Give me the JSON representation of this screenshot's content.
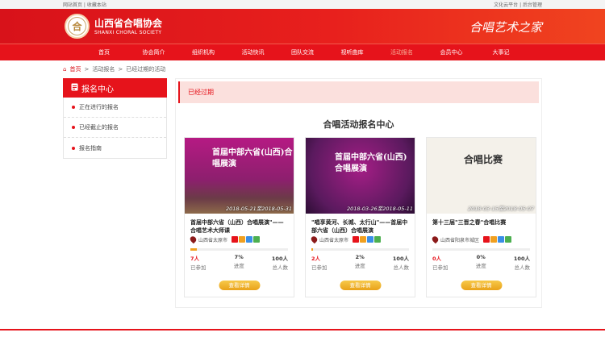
{
  "topbar": {
    "left": "网站首页 | 收藏本站",
    "right": "文化云平台 | 后台管理"
  },
  "brand": {
    "logo_glyph": "合",
    "name": "山西省合唱协会",
    "name_en": "SHANXI CHORAL SOCIETY",
    "slogan": "合唱艺术之家"
  },
  "nav": [
    {
      "label": "首页",
      "active": false
    },
    {
      "label": "协会简介",
      "active": false
    },
    {
      "label": "组织机构",
      "active": false
    },
    {
      "label": "活动快讯",
      "active": false
    },
    {
      "label": "团队交流",
      "active": false
    },
    {
      "label": "视听曲库",
      "active": false
    },
    {
      "label": "活动报名",
      "active": true
    },
    {
      "label": "会员中心",
      "active": false
    },
    {
      "label": "大事记",
      "active": false
    }
  ],
  "breadcrumb": {
    "home": "首页",
    "sep": ">",
    "level1": "活动报名",
    "level2": "已经过期的活动"
  },
  "sidebar": {
    "title": "报名中心",
    "items": [
      {
        "label": "正在进行的报名"
      },
      {
        "label": "已经截止的报名"
      },
      {
        "label": "报名指南"
      }
    ]
  },
  "main": {
    "section_label": "已经过期",
    "title": "合唱活动报名中心",
    "cards": [
      {
        "poster_text": "首届中部六省(山西)合唱展演",
        "date_range": "2018-05-21至2018-05-31",
        "title": "首届中部六省（山西）合唱展演\"——合唱艺术大师课",
        "location": "山西省太原市",
        "progress_percent": 7,
        "joined": "7人",
        "joined_label": "已参加",
        "progress_text": "7%",
        "progress_label": "进度",
        "total": "100人",
        "total_label": "总人数",
        "button": "查看详情"
      },
      {
        "poster_text": "首届中部六省(山西)合唱展演",
        "date_range": "2018-03-26至2018-05-11",
        "title": "\"唱享黄河、长城、太行山\"——首届中部六省（山西）合唱展演",
        "location": "山西省太原市",
        "progress_percent": 2,
        "joined": "2人",
        "joined_label": "已参加",
        "progress_text": "2%",
        "progress_label": "进度",
        "total": "100人",
        "total_label": "总人数",
        "button": "查看详情"
      },
      {
        "poster_text": "合唱比赛",
        "date_range": "2018-03-15至2018-05-07",
        "title": "第十三届\"三晋之春\"合唱比赛",
        "location": "山西省阳泉市城区",
        "progress_percent": 0,
        "joined": "0人",
        "joined_label": "已参加",
        "progress_text": "0%",
        "progress_label": "进度",
        "total": "100人",
        "total_label": "总人数",
        "button": "查看详情"
      }
    ]
  },
  "colors": {
    "brand_red": "#e6131b",
    "button_gold": "#e9a21a",
    "tag_colors": [
      "#e6131b",
      "#f0a020",
      "#3a8ee6",
      "#4caf50"
    ]
  }
}
